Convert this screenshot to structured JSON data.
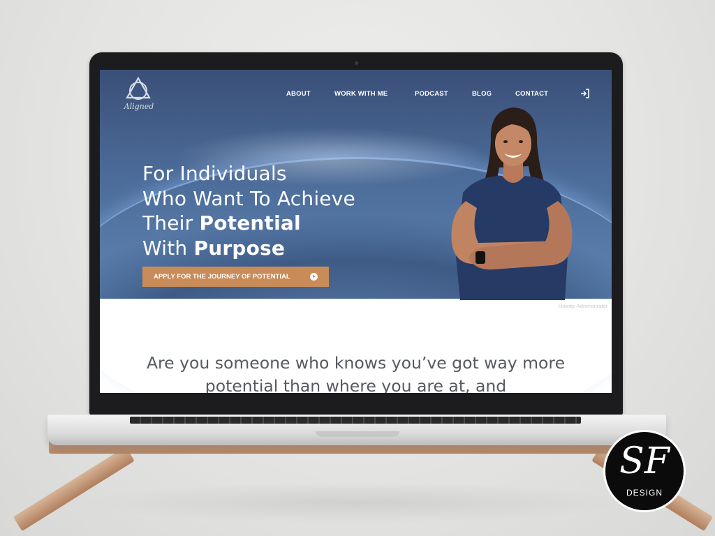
{
  "nav": {
    "items": [
      {
        "label": "ABOUT"
      },
      {
        "label": "WORK WITH ME"
      },
      {
        "label": "PODCAST"
      },
      {
        "label": "BLOG"
      },
      {
        "label": "CONTACT"
      }
    ],
    "login_icon": "login-icon"
  },
  "logo": {
    "script": "Aligned",
    "icon": "triangle-circle-logo"
  },
  "hero": {
    "line1": "For Individuals",
    "line2": "Who Want To Achieve",
    "line3_prefix": "Their ",
    "line3_bold": "Potential",
    "line4_prefix": "With ",
    "line4_bold": "Purpose",
    "cta_label": "APPLY FOR THE JOURNEY OF POTENTIAL",
    "cta_icon": "arrow-circle-right-icon",
    "cta_color": "#c98b57"
  },
  "admin_bar_text": "Howdy, Administrator",
  "teaser": "Are you someone who knows you’ve got way more potential than where you are at, and",
  "badge": {
    "mark": "SF",
    "sub": "DESIGN"
  }
}
